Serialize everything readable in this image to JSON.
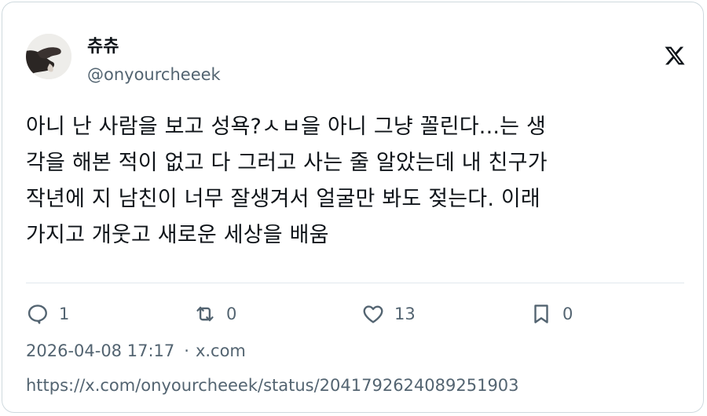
{
  "author": {
    "display_name": "츄츄",
    "handle": "@onyourcheeek"
  },
  "tweet": {
    "text": "아니 난 사람을 보고 성욕?ㅅㅂ을 아니 그냥 꼴린다...는 생\n각을 해본 적이 없고 다 그러고 사는 줄 알았는데 내 친구가\n작년에 지 남친이 너무 잘생겨서 얼굴만 봐도 젖는다. 이래\n가지고 개웃고 새로운 세상을 배움"
  },
  "actions": {
    "reply_count": "1",
    "retweet_count": "0",
    "like_count": "13",
    "bookmark_count": "0"
  },
  "meta": {
    "timestamp": "2026-04-08 17:17",
    "separator": "·",
    "source": "x.com",
    "url": "https://x.com/onyourcheeek/status/2041792624089251903"
  },
  "icons": {
    "platform": "x-logo-icon",
    "reply": "speech-bubble-icon",
    "retweet": "retweet-arrows-icon",
    "like": "heart-icon",
    "bookmark": "bookmark-icon"
  },
  "colors": {
    "text": "#0f1419",
    "muted": "#536471",
    "border": "#cfd9de"
  }
}
